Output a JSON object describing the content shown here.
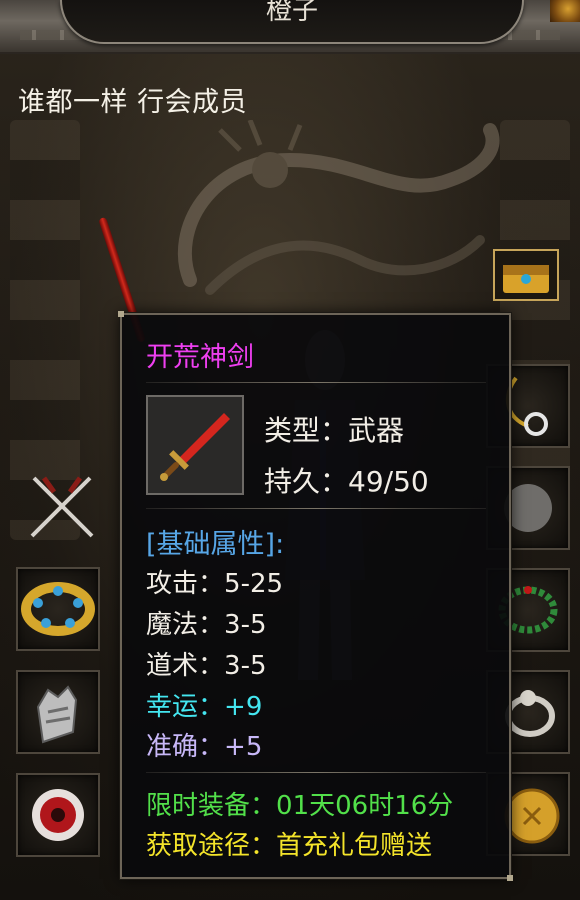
{
  "header": {
    "title": "橙子"
  },
  "character": {
    "guild_line": "谁都一样 行会成员"
  },
  "tooltip": {
    "item_name": "开荒神剑",
    "type_label": "类型",
    "type_value": "武器",
    "durability_label": "持久",
    "durability_value": "49/50",
    "base_attrs_label": "[基础属性]:",
    "stats": [
      {
        "label": "攻击",
        "value": "5-25"
      },
      {
        "label": "魔法",
        "value": "3-5"
      },
      {
        "label": "道术",
        "value": "3-5"
      },
      {
        "label": "幸运",
        "value": "+9"
      },
      {
        "label": "准确",
        "value": "+5"
      }
    ],
    "limited_label": "限时装备",
    "limited_value": "01天06时16分",
    "source_label": "获取途径",
    "source_value": "首充礼包赠送"
  },
  "colors": {
    "item_name": "#ee3ff0",
    "section": "#57a6e6",
    "luck": "#44e6f0",
    "accuracy": "#c8b8f8",
    "limited": "#52e04a",
    "source": "#f4e42a"
  },
  "icons": {
    "weapon": "red-sword-icon",
    "chest": "treasure-chest-icon",
    "necklace": "necklace-icon",
    "bracelet": "gold-bracelet-icon",
    "glove": "glove-icon",
    "gem": "red-eye-gem-icon",
    "beads": "bead-bracelet-icon",
    "ring": "ring-icon",
    "medal": "gold-medal-icon",
    "crossed_swords": "crossed-swords-icon"
  }
}
